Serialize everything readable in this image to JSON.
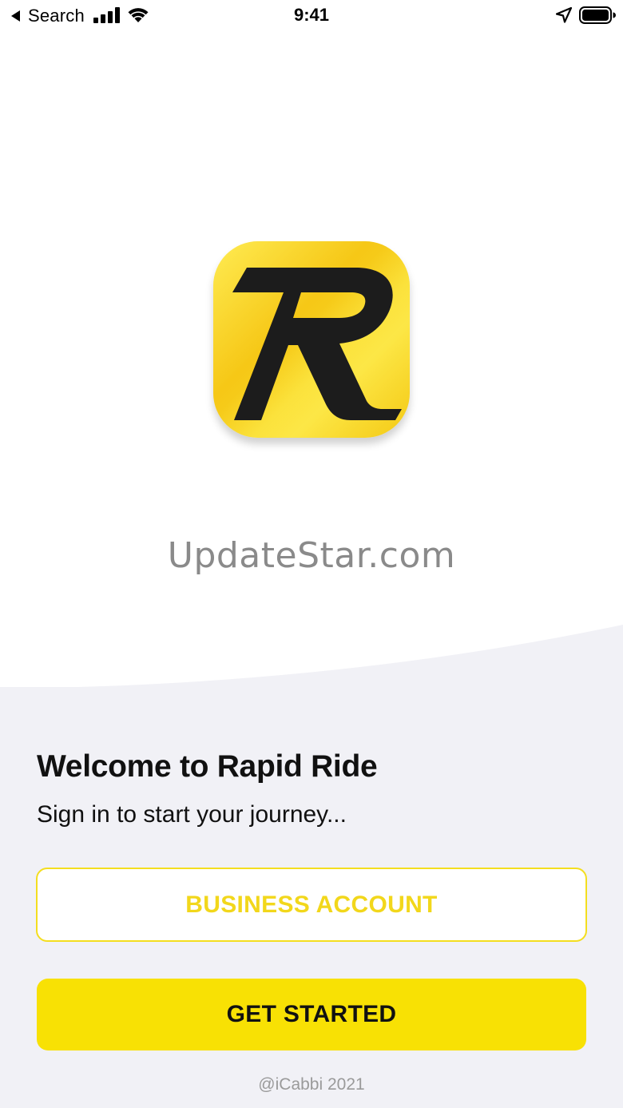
{
  "status_bar": {
    "back_label": "Search",
    "time": "9:41"
  },
  "brand": {
    "logo_icon": "rapid-ride-r-logo",
    "watermark": "UpdateStar.com"
  },
  "welcome": {
    "title": "Welcome to Rapid Ride",
    "subtitle": "Sign in to start your journey..."
  },
  "actions": {
    "business_label": "BUSINESS ACCOUNT",
    "start_label": "GET STARTED"
  },
  "footer": {
    "copyright": "@iCabbi 2021"
  },
  "colors": {
    "accent_yellow": "#f8e104",
    "outline_yellow": "#f4de1f",
    "panel_background": "#f1f1f6"
  }
}
